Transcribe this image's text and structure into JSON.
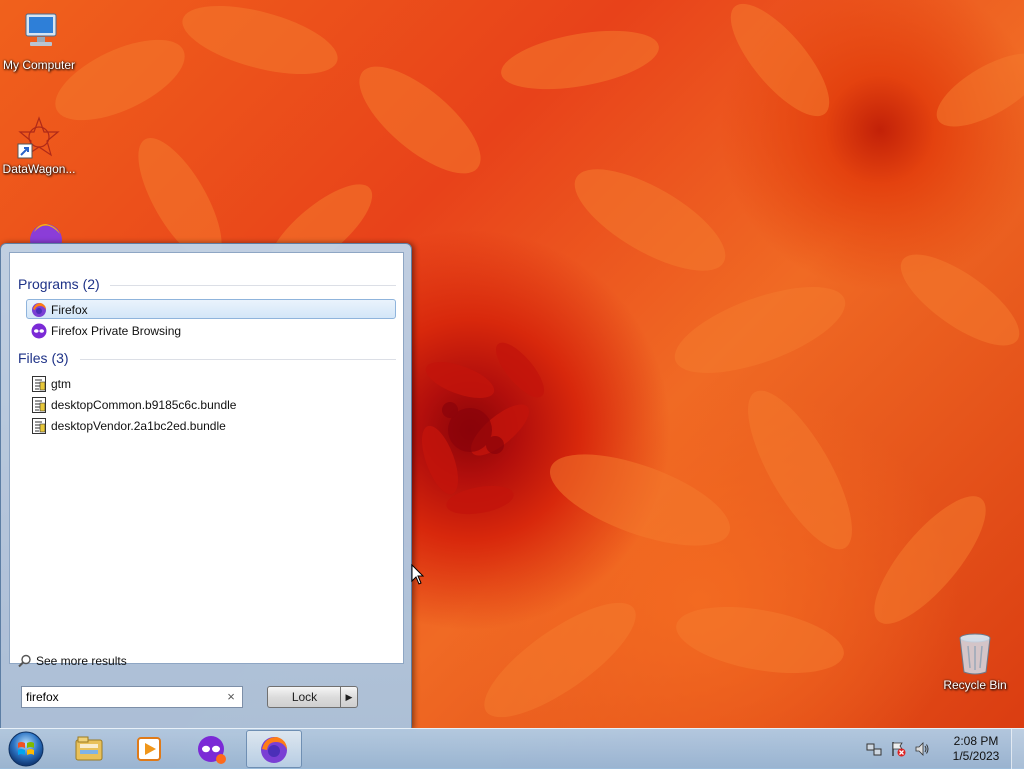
{
  "desktop": {
    "icons": [
      {
        "label": "My Computer",
        "icon": "computer-icon"
      },
      {
        "label": "DataWagon...",
        "icon": "datawagon-icon"
      },
      {
        "label": "Recycle Bin",
        "icon": "recycle-bin-icon"
      }
    ]
  },
  "start_menu": {
    "programs_header": "Programs (2)",
    "programs": [
      {
        "label": "Firefox",
        "icon": "firefox-icon",
        "selected": true
      },
      {
        "label": "Firefox Private Browsing",
        "icon": "firefox-private-icon",
        "selected": false
      }
    ],
    "files_header": "Files (3)",
    "files": [
      {
        "label": "gtm",
        "icon": "script-file-icon"
      },
      {
        "label": "desktopCommon.b9185c6c.bundle",
        "icon": "script-file-icon"
      },
      {
        "label": "desktopVendor.2a1bc2ed.bundle",
        "icon": "script-file-icon"
      }
    ],
    "see_more": "See more results",
    "search": {
      "value": "firefox",
      "clear": "×"
    },
    "lock_label": "Lock",
    "lock_arrow": "▶"
  },
  "taskbar": {
    "buttons": [
      {
        "name": "windows-explorer",
        "icon": "folder-icon",
        "active": false
      },
      {
        "name": "media-player",
        "icon": "media-player-icon",
        "active": false
      },
      {
        "name": "firefox-private",
        "icon": "firefox-private-icon",
        "active": false
      },
      {
        "name": "firefox",
        "icon": "firefox-icon",
        "active": true
      }
    ],
    "clock": {
      "time": "2:08 PM",
      "date": "1/5/2023"
    }
  },
  "colors": {
    "header_blue": "#1e3287",
    "wallpaper_orange": "#f0611c",
    "taskbar_blue": "#a8c4e2"
  }
}
